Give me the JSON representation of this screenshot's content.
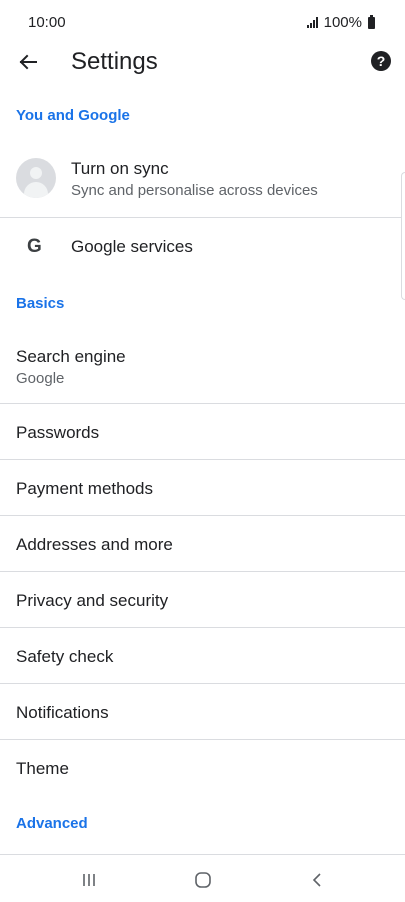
{
  "status_bar": {
    "time": "10:00",
    "battery": "100%"
  },
  "toolbar": {
    "title": "Settings"
  },
  "sections": {
    "you_and_google": "You and Google",
    "basics": "Basics",
    "advanced": "Advanced"
  },
  "sync": {
    "label": "Turn on sync",
    "sublabel": "Sync and personalise across devices"
  },
  "google_services": {
    "icon_letter": "G",
    "label": "Google services"
  },
  "search_engine": {
    "label": "Search engine",
    "sublabel": "Google"
  },
  "items": {
    "passwords": "Passwords",
    "payment_methods": "Payment methods",
    "addresses": "Addresses and more",
    "privacy": "Privacy and security",
    "safety_check": "Safety check",
    "notifications": "Notifications",
    "theme": "Theme"
  },
  "colors": {
    "accent": "#1a73e8",
    "text": "#202124",
    "secondary": "#5f6368",
    "divider": "#dadce0"
  },
  "icons": {
    "back": "arrow-left-icon",
    "help": "help-circle-icon",
    "avatar": "account-icon",
    "google": "google-g-icon",
    "nav_recents": "recents-icon",
    "nav_home": "home-icon",
    "nav_back": "chevron-left-icon"
  }
}
